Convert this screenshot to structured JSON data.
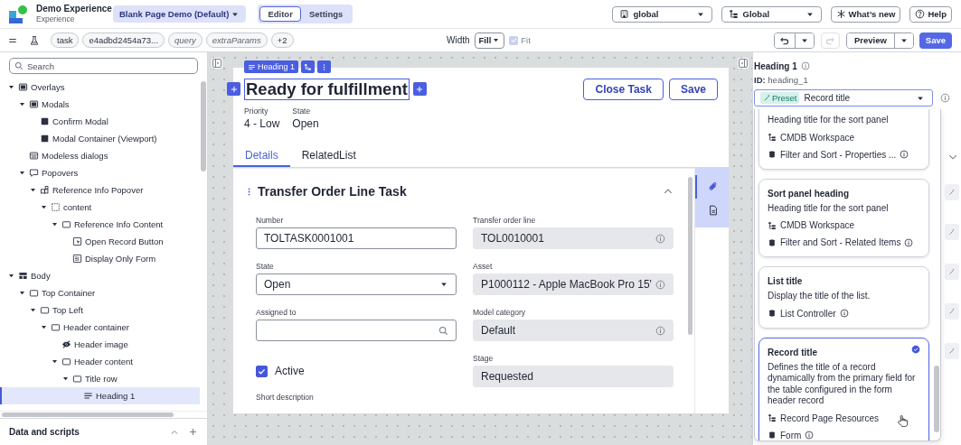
{
  "header": {
    "app_name": "Demo Experience",
    "app_subtitle": "Experience",
    "page_selector": "Blank Page Demo (Default)",
    "mode_tabs": [
      {
        "label": "Editor",
        "selected": true
      },
      {
        "label": "Settings",
        "selected": false
      }
    ],
    "dropdowns": [
      {
        "kind": "scope",
        "value": "global"
      },
      {
        "kind": "application",
        "value": "Global"
      }
    ],
    "buttons": [
      {
        "kind": "whats-new",
        "label": "What’s new"
      },
      {
        "kind": "help",
        "label": "Help"
      }
    ]
  },
  "toolbar": {
    "params": [
      {
        "label": "task",
        "optional": false
      },
      {
        "label": "e4adbd2454a73...",
        "optional": false
      },
      {
        "label": "query",
        "optional": true
      },
      {
        "label": "extraParams",
        "optional": true
      },
      {
        "label": "+2",
        "optional": false
      }
    ],
    "width_label": "Width",
    "width_value": "Fill",
    "fit": {
      "label": "Fit",
      "checked": true,
      "disabled": true
    },
    "undo": {
      "disabled": false
    },
    "redo": {
      "disabled": true
    },
    "preview": "Preview",
    "save": "Save"
  },
  "left_panel": {
    "search": {
      "placeholder": "Search"
    },
    "tree": [
      {
        "label": "Overlays",
        "kind": "overlay",
        "expanded": true,
        "selected": false,
        "children": [
          {
            "label": "Modals",
            "kind": "overlay",
            "expanded": true,
            "selected": false,
            "children": [
              {
                "label": "Confirm Modal",
                "kind": "modal",
                "selected": false
              },
              {
                "label": "Modal Container (Viewport)",
                "kind": "modal",
                "selected": false
              }
            ]
          },
          {
            "label": "Modeless dialogs",
            "kind": "dialog",
            "selected": false
          },
          {
            "label": "Popovers",
            "kind": "popover",
            "expanded": true,
            "selected": false,
            "children": [
              {
                "label": "Reference Info Popover",
                "kind": "component",
                "expanded": true,
                "selected": false,
                "children": [
                  {
                    "label": "content",
                    "kind": "slot",
                    "expanded": true,
                    "selected": false,
                    "children": [
                      {
                        "label": "Reference Info Content",
                        "kind": "container",
                        "expanded": true,
                        "selected": false,
                        "children": [
                          {
                            "label": "Open Record Button",
                            "kind": "button",
                            "selected": false
                          },
                          {
                            "label": "Display Only Form",
                            "kind": "form",
                            "selected": false
                          }
                        ]
                      }
                    ]
                  }
                ]
              }
            ]
          }
        ]
      },
      {
        "label": "Body",
        "kind": "layout",
        "expanded": true,
        "selected": false,
        "children": [
          {
            "label": "Top Container",
            "kind": "container",
            "expanded": true,
            "selected": false,
            "children": [
              {
                "label": "Top Left",
                "kind": "container",
                "expanded": true,
                "selected": false,
                "children": [
                  {
                    "label": "Header container",
                    "kind": "container",
                    "expanded": true,
                    "selected": false,
                    "children": [
                      {
                        "label": "Header image",
                        "kind": "image",
                        "selected": false
                      },
                      {
                        "label": "Header content",
                        "kind": "container",
                        "expanded": true,
                        "selected": false,
                        "children": [
                          {
                            "label": "Title row",
                            "kind": "container",
                            "expanded": true,
                            "selected": false,
                            "children": [
                              {
                                "label": "Heading 1",
                                "kind": "heading",
                                "selected": true
                              }
                            ]
                          }
                        ]
                      }
                    ]
                  }
                ]
              }
            ]
          }
        ]
      }
    ],
    "bottom_section": "Data and scripts"
  },
  "canvas": {
    "selection_label": "Heading 1",
    "page": {
      "title": "Ready for fulfillment",
      "actions": [
        "Close Task",
        "Save"
      ],
      "meta": [
        {
          "label": "Priority",
          "value": "4 - Low"
        },
        {
          "label": "State",
          "value": "Open"
        }
      ],
      "tabs": [
        {
          "label": "Details",
          "selected": true
        },
        {
          "label": "RelatedList",
          "selected": false
        }
      ],
      "section_title": "Transfer Order Line Task",
      "section_expanded": true,
      "left_fields": [
        {
          "kind": "text",
          "label": "Number",
          "value": "TOLTASK0001001"
        },
        {
          "kind": "select",
          "label": "State",
          "value": "Open"
        },
        {
          "kind": "lookup",
          "label": "Assigned to"
        },
        {
          "kind": "checkbox",
          "label": "Active",
          "checked": true
        },
        {
          "kind": "label",
          "label": "Short description"
        }
      ],
      "right_fields": [
        {
          "kind": "readonly",
          "label": "Transfer order line",
          "value": "TOL0010001",
          "info": true
        },
        {
          "kind": "readonly",
          "label": "Asset",
          "value": "P1000112 - Apple MacBook Pro 15'",
          "info": true
        },
        {
          "kind": "readonly",
          "label": "Model category",
          "value": "Default",
          "info": true
        },
        {
          "kind": "readonly",
          "label": "Stage",
          "value": "Requested",
          "info": false
        }
      ],
      "sidebar": [
        {
          "kind": "attachment",
          "selected": true
        },
        {
          "kind": "document",
          "selected": false
        }
      ]
    }
  },
  "right_panel": {
    "title": "Heading 1",
    "id_label": "ID:",
    "id": "heading_1",
    "preset_badge": "Preset",
    "preset_value": "Record title",
    "presets": [
      {
        "description": "Heading title for the sort panel",
        "workspace": "CMDB Workspace",
        "source": "Filter and Sort - Properties ...",
        "selected": false
      },
      {
        "title": "Sort panel heading",
        "description": "Heading title for the sort panel",
        "workspace": "CMDB Workspace",
        "source": "Filter and Sort - Related Items",
        "selected": false
      },
      {
        "title": "List title",
        "description": "Display the title of the list.",
        "source": "List Controller",
        "selected": false
      },
      {
        "title": "Record title",
        "description": "Defines the title of a record dynamically from the primary field for the table configured in the form header record",
        "workspace": "Record Page Resources",
        "source": "Form",
        "selected": true
      }
    ]
  }
}
